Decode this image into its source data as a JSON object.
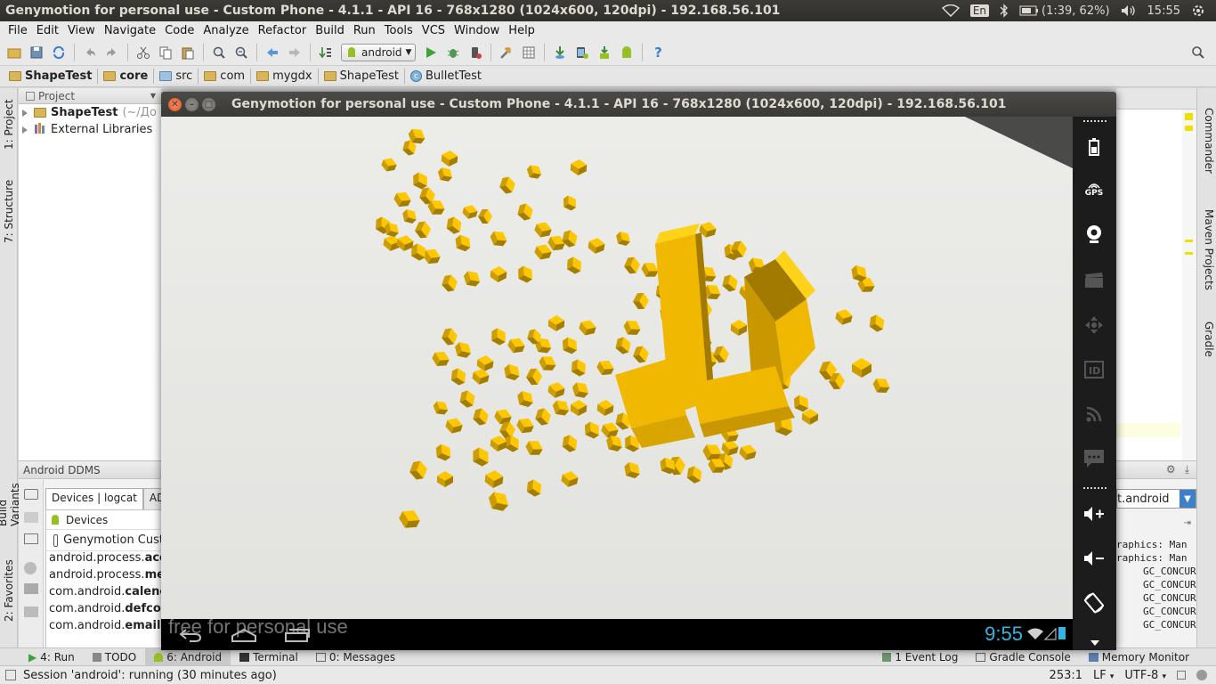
{
  "system_panel": {
    "window_title": "Genymotion for personal use - Custom Phone - 4.1.1 - API 16 - 768x1280 (1024x600, 120dpi) - 192.168.56.101",
    "keyboard_layout": "En",
    "battery": "(1:39, 62%)",
    "clock": "15:55"
  },
  "menu": [
    "File",
    "Edit",
    "View",
    "Navigate",
    "Code",
    "Analyze",
    "Refactor",
    "Build",
    "Run",
    "Tools",
    "VCS",
    "Window",
    "Help"
  ],
  "toolbar": {
    "run_config": "android"
  },
  "breadcrumb": [
    {
      "label": "ShapeTest",
      "kind": "folder",
      "bold": true
    },
    {
      "label": "core",
      "kind": "folder",
      "bold": true
    },
    {
      "label": "src",
      "kind": "src"
    },
    {
      "label": "com",
      "kind": "folder"
    },
    {
      "label": "mygdx",
      "kind": "folder"
    },
    {
      "label": "ShapeTest",
      "kind": "folder"
    },
    {
      "label": "BulletTest",
      "kind": "class"
    }
  ],
  "left_strip": {
    "project": "1: Project",
    "structure": "7: Structure",
    "build_variants": "Build Variants",
    "favorites": "2: Favorites"
  },
  "right_strip": {
    "commander": "Commander",
    "maven": "Maven Projects",
    "gradle": "Gradle"
  },
  "project_panel": {
    "header": "Project",
    "items": [
      {
        "label": "ShapeTest",
        "suffix": "(~/До"
      },
      {
        "label": "External Libraries",
        "suffix": ""
      }
    ]
  },
  "ddms": {
    "title": "Android DDMS",
    "tabs": [
      "Devices | logcat",
      "ADB"
    ],
    "devices_header": "Devices",
    "device": "Genymotion Cust",
    "processes": [
      {
        "prefix": "android.process.",
        "bold": "aco"
      },
      {
        "prefix": "android.process.",
        "bold": "me"
      },
      {
        "prefix": "com.android.",
        "bold": "calenc"
      },
      {
        "prefix": "com.android.",
        "bold": "defcon"
      },
      {
        "prefix": "com.android.",
        "bold": "email"
      }
    ],
    "filter": "t.android",
    "log_lines": [
      "raphics: Man",
      "raphics: Man",
      "GC_CONCURI",
      "GC_CONCURI",
      "GC_CONCURI",
      "GC_CONCURI",
      "GC_CONCURI"
    ]
  },
  "tool_tabs": {
    "left": [
      {
        "label": "4: Run",
        "icon": "run-icon"
      },
      {
        "label": "TODO",
        "icon": "todo-icon"
      },
      {
        "label": "6: Android",
        "icon": "android-icon",
        "active": true
      },
      {
        "label": "Terminal",
        "icon": "terminal-icon"
      },
      {
        "label": "0: Messages",
        "icon": "messages-icon"
      }
    ],
    "right": [
      {
        "label": "1 Event Log",
        "icon": "event-log-icon"
      },
      {
        "label": "Gradle Console",
        "icon": "gradle-console-icon"
      },
      {
        "label": "Memory Monitor",
        "icon": "memory-icon"
      }
    ]
  },
  "status_bar": {
    "message": "Session 'android': running (30 minutes ago)",
    "position": "253:1",
    "line_separator": "LF",
    "encoding": "UTF-8"
  },
  "genymotion": {
    "title": "Genymotion for personal use - Custom Phone - 4.1.1 - API 16 - 768x1280 (1024x600, 120dpi) - 192.168.56.101",
    "watermark": "free for personal use",
    "android_clock": "9:55",
    "side_icons": [
      "battery-icon",
      "gps-icon",
      "webcam-icon",
      "capture-icon",
      "dpad-icon",
      "device-id-icon",
      "network-icon",
      "sms-icon",
      "volume-up-icon",
      "volume-down-icon",
      "rotate-icon"
    ],
    "gps_label": "GPS",
    "id_label": "ID",
    "cube_color": "#f0b800"
  }
}
